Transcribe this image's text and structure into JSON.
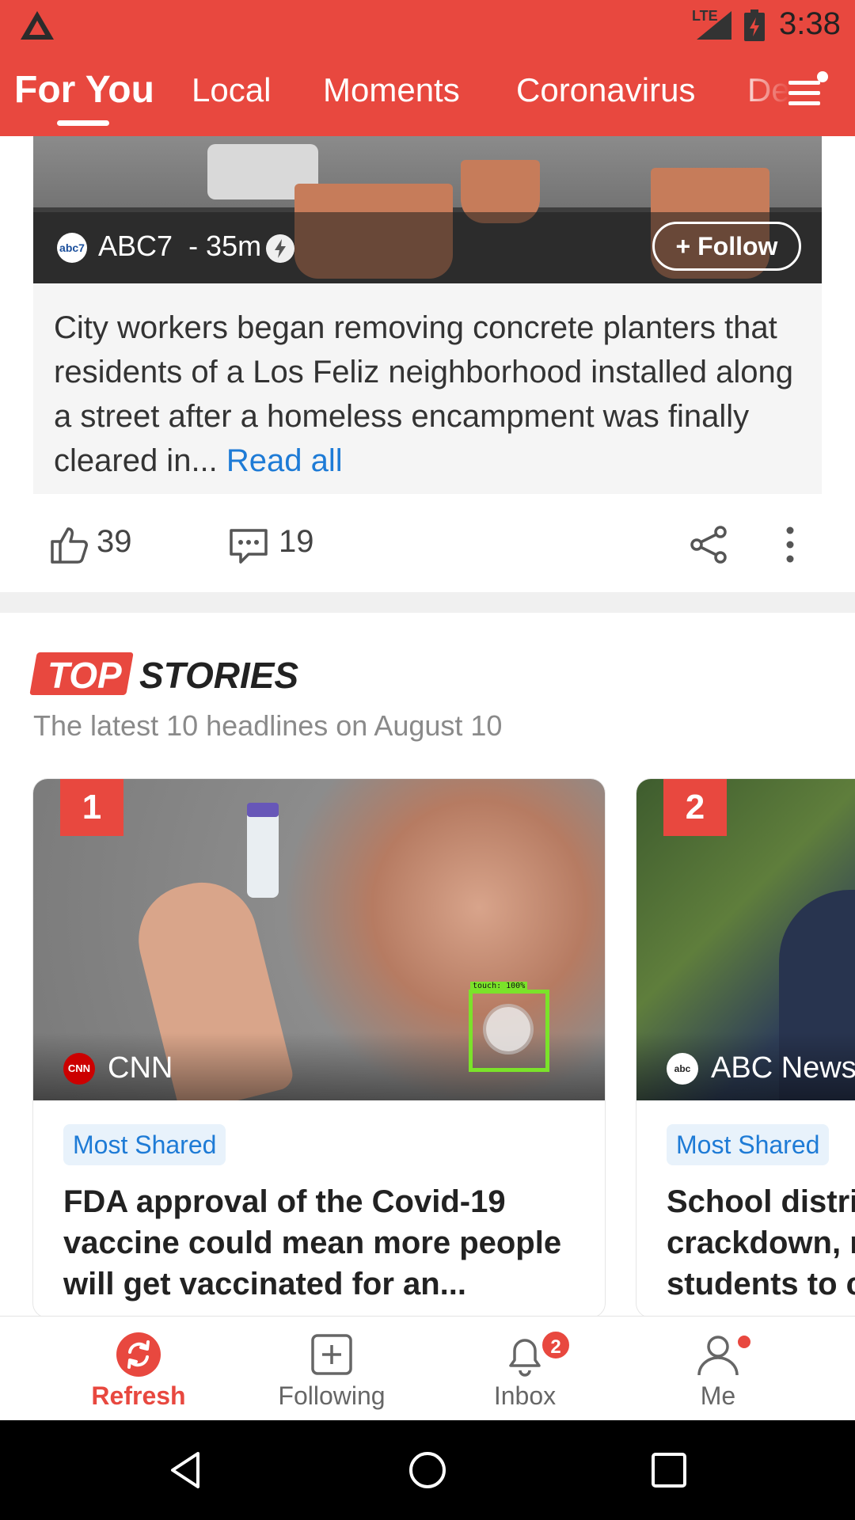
{
  "status_bar": {
    "network": "LTE",
    "time": "3:38"
  },
  "tabs": [
    {
      "label": "For You",
      "active": true
    },
    {
      "label": "Local"
    },
    {
      "label": "Moments"
    },
    {
      "label": "Coronavirus"
    },
    {
      "label": "De"
    }
  ],
  "feed_card": {
    "source": "ABC7",
    "source_logo_text": "abc7",
    "age": "- 35m",
    "follow_label": "+ Follow",
    "summary": "City workers began removing concrete planters that residents of a Los Feliz neighborhood installed along a street after a homeless encampment was finally cleared in...",
    "read_all": "Read all",
    "likes": "39",
    "comments": "19"
  },
  "top_stories": {
    "top_word": "TOP",
    "stories_word": "STORIES",
    "subtitle": "The latest 10 headlines on August 10",
    "cards": [
      {
        "rank": "1",
        "source": "CNN",
        "source_logo_text": "CNN",
        "tag": "Most Shared",
        "headline": "FDA approval of the Covid-19 vaccine could mean more people will get vaccinated for an..."
      },
      {
        "rank": "2",
        "source": "ABC News",
        "source_logo_text": "abc",
        "tag": "Most Shared",
        "headline": "School distri crackdown, r students to c"
      }
    ]
  },
  "touch_overlay": {
    "label": "touch: 100%"
  },
  "bottom_nav": [
    {
      "label": "Refresh",
      "icon": "refresh-icon",
      "active": true
    },
    {
      "label": "Following",
      "icon": "plus-square-icon"
    },
    {
      "label": "Inbox",
      "icon": "bell-icon",
      "badge": "2"
    },
    {
      "label": "Me",
      "icon": "person-icon"
    }
  ],
  "colors": {
    "brand": "#e8483f",
    "link": "#1e7bd6",
    "chip_bg": "#e8f2fb"
  }
}
